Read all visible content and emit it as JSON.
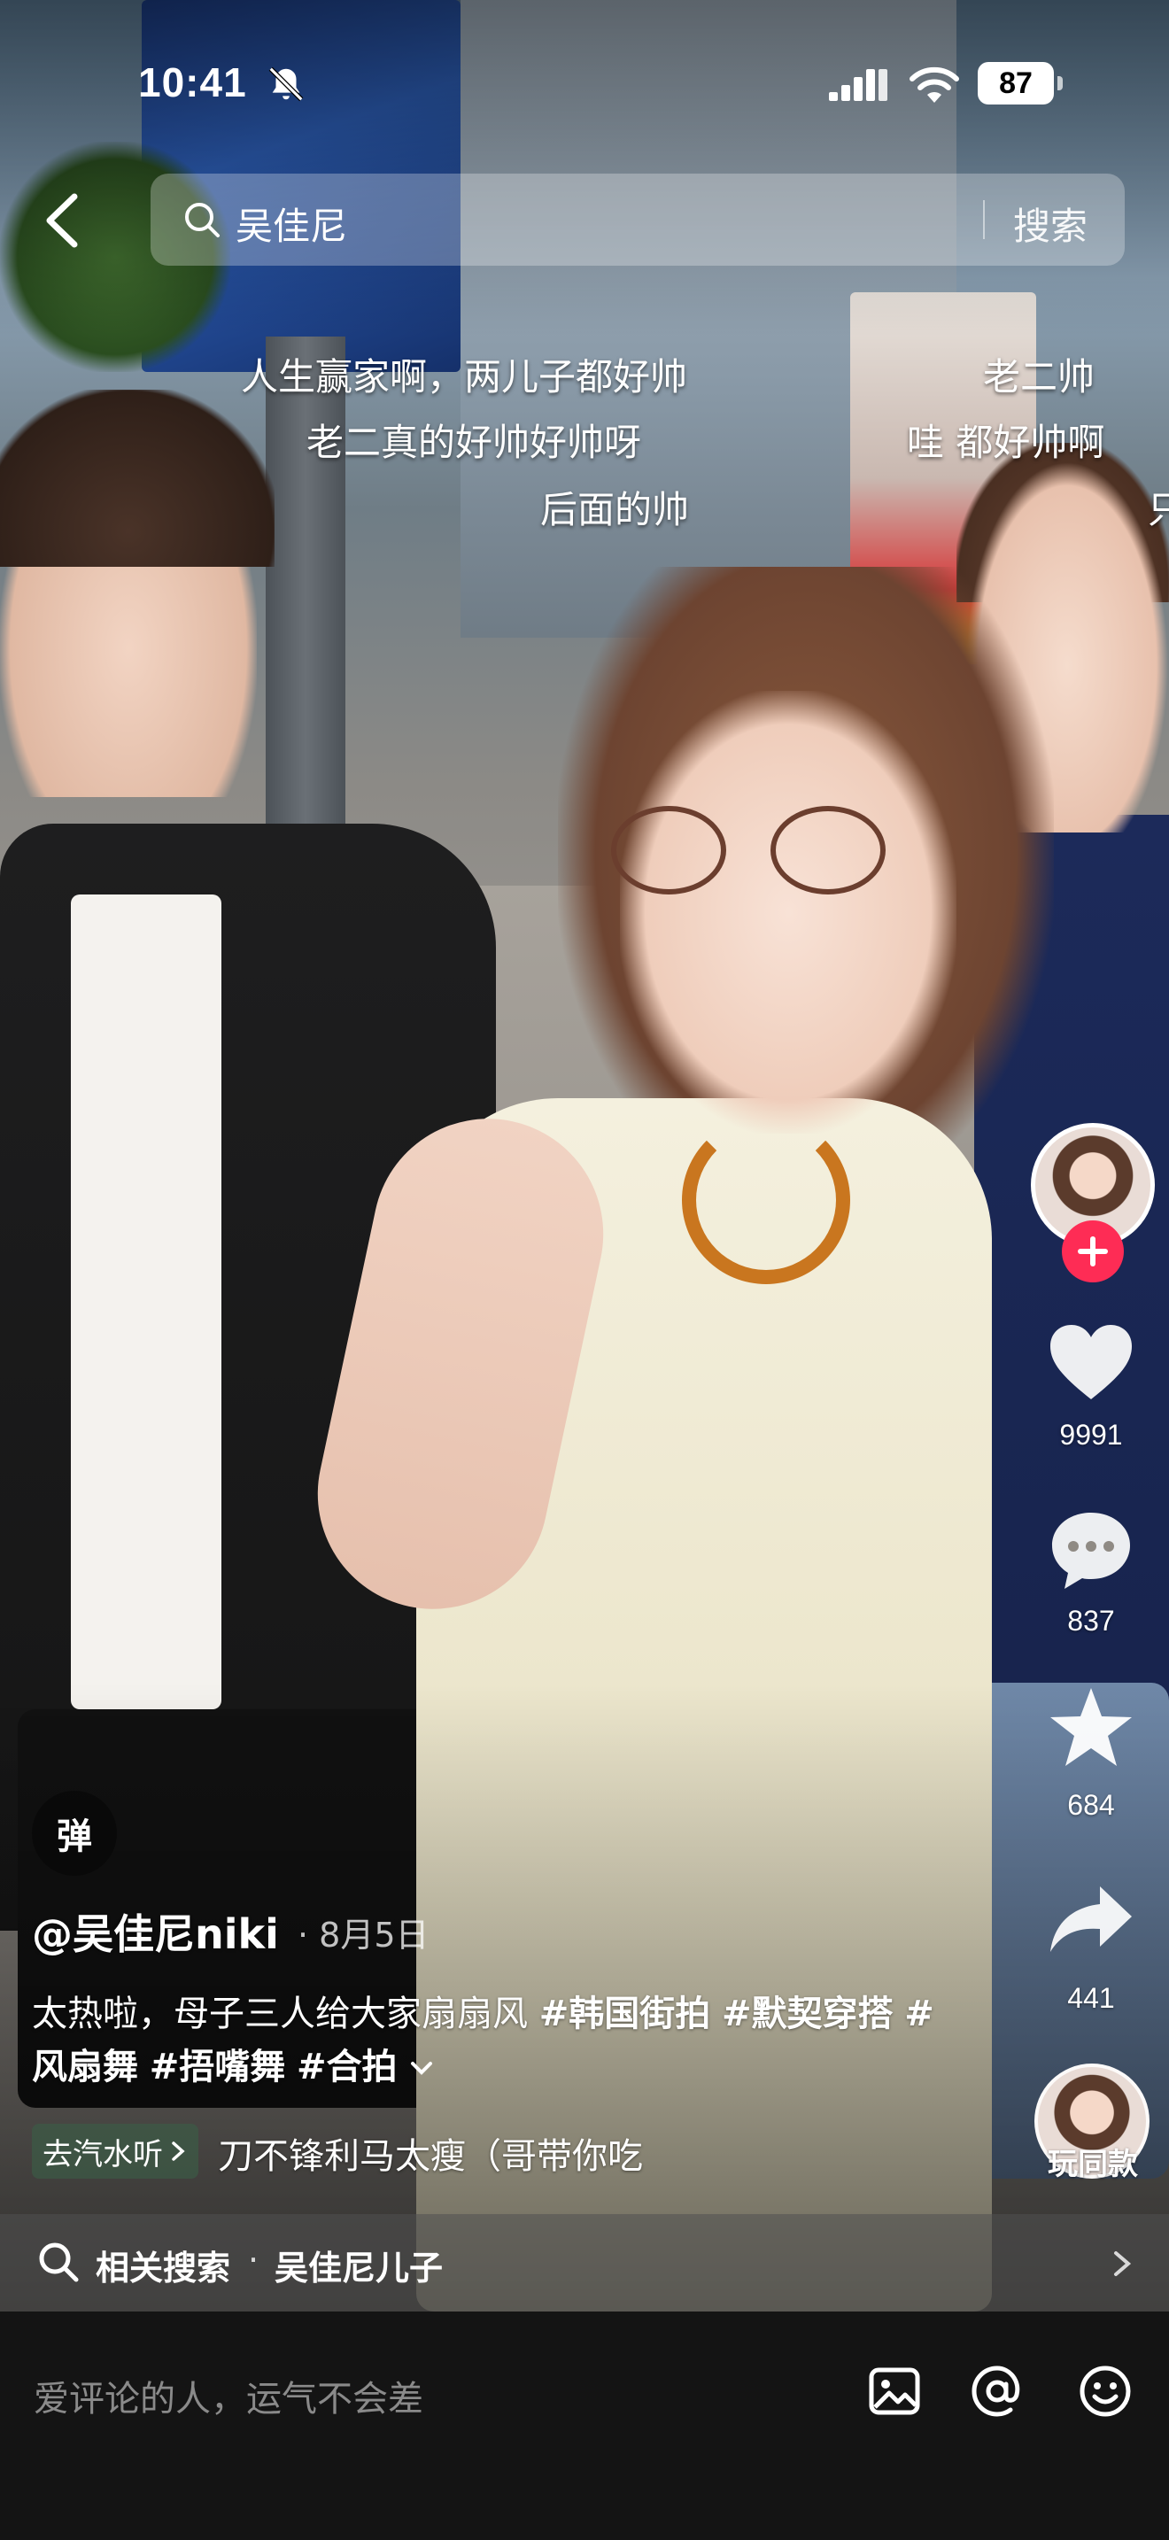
{
  "status_bar": {
    "time": "10:41",
    "battery": "87"
  },
  "search": {
    "query": "吴佳尼",
    "button": "搜索"
  },
  "danmaku": [
    "人生赢家啊，两儿子都好帅",
    "老二帅",
    "老二真的好帅好帅呀",
    "哇 都好帅啊",
    "后面的帅",
    "只"
  ],
  "actions": {
    "likes": "9991",
    "comments": "837",
    "favorites": "684",
    "shares": "441",
    "same_style": "玩同款"
  },
  "danmu_toggle": "弹",
  "post": {
    "author": "@吴佳尼niki",
    "date": "· 8月5日",
    "caption_text": "太热啦，母子三人给大家扇扇风 ",
    "tags": [
      "#韩国街拍",
      "#默契穿搭",
      "#风扇舞",
      "#捂嘴舞",
      "#合拍"
    ],
    "music_badge": "去汽水听",
    "music_title": "刀不锋利马太瘦（哥带你吃"
  },
  "related": {
    "label": "相关搜索",
    "separator": "·",
    "query": "吴佳尼儿子"
  },
  "comment": {
    "placeholder": "爱评论的人，运气不会差"
  },
  "colors": {
    "accent": "#fe2c55",
    "bar_bg": "#141414"
  }
}
